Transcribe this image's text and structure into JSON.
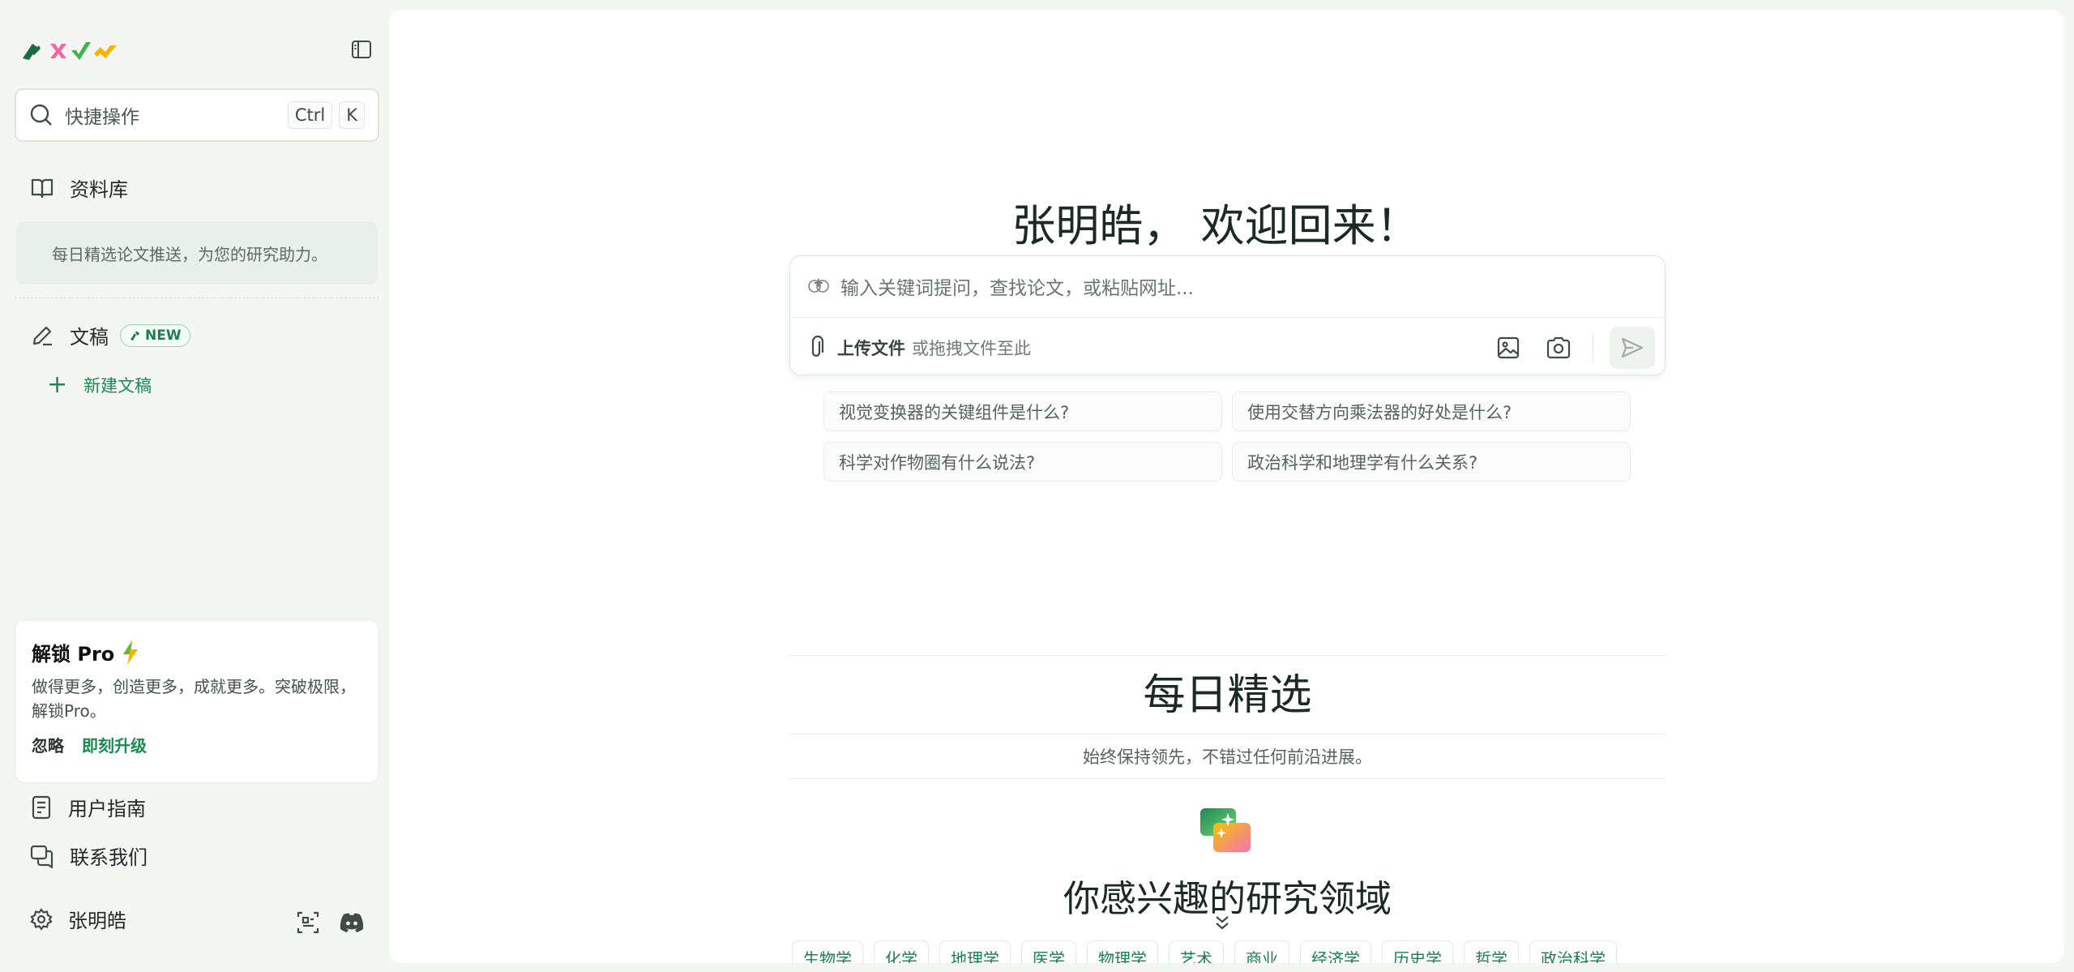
{
  "sidebar": {
    "search": {
      "placeholder": "快捷操作",
      "key1": "Ctrl",
      "key2": "K"
    },
    "library": {
      "label": "资料库",
      "note": "每日精选论文推送，为您的研究助力。"
    },
    "drafts": {
      "label": "文稿",
      "badge": "NEW",
      "new_draft": "新建文稿"
    },
    "pro_card": {
      "title": "解锁 Pro",
      "description": "做得更多，创造更多，成就更多。突破极限，解锁Pro。",
      "ignore": "忽略",
      "upgrade": "即刻升级"
    },
    "user_guide": "用户指南",
    "contact": "联系我们",
    "user_name": "张明皓"
  },
  "main": {
    "welcome": "张明皓， 欢迎回来！",
    "chat": {
      "placeholder": "输入关键词提问，查找论文，或粘贴网址...",
      "upload_label": "上传文件",
      "drag_hint": "或拖拽文件至此"
    },
    "suggestions": [
      "视觉变换器的关键组件是什么?",
      "使用交替方向乘法器的好处是什么?",
      "科学对作物圈有什么说法?",
      "政治科学和地理学有什么关系?"
    ],
    "daily": {
      "title": "每日精选",
      "subtitle": "始终保持领先，不错过任何前沿进展。"
    },
    "interests": {
      "title": "你感兴趣的研究领域",
      "fields": [
        "生物学",
        "化学",
        "地理学",
        "医学",
        "物理学",
        "艺术",
        "商业",
        "经济学",
        "历史学",
        "哲学",
        "政治科学"
      ]
    }
  },
  "colors": {
    "accent": "#1b8a52",
    "sidebar_bg": "#f4f6f3",
    "main_bg": "#ffffff"
  },
  "icons": {
    "logo": "brand-logo",
    "collapse": "sidebar-toggle-icon",
    "search": "search-icon",
    "library": "book-open-icon",
    "drafts": "pen-icon",
    "add": "plus-icon",
    "bolt": "lightning-icon",
    "guide": "document-icon",
    "contact": "chat-bubbles-icon",
    "settings": "gear-icon",
    "scan": "scan-icon",
    "discord": "discord-icon",
    "attach": "paperclip-icon",
    "image": "image-icon",
    "camera": "camera-icon",
    "send": "send-icon",
    "chevron": "chevrons-down-icon"
  }
}
